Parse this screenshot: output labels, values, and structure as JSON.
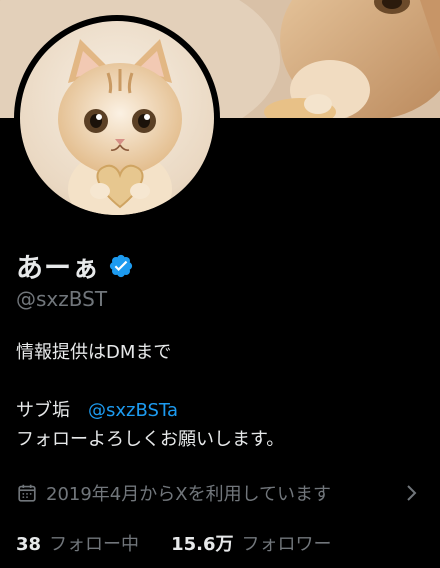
{
  "profile": {
    "display_name": "あーぁ",
    "handle": "@sxzBST",
    "verified_icon": "verified-badge-icon",
    "avatar_icon": "kitten-avatar"
  },
  "bio": {
    "line1": "情報提供はDMまで",
    "line3_label": "サブ垢",
    "line3_mention": "@sxzBSTa",
    "line4": "フォローよろしくお願いします。"
  },
  "joined": {
    "text": "2019年4月からXを利用しています",
    "icon": "calendar-icon"
  },
  "stats": {
    "following_count": "38",
    "following_label": "フォロー中",
    "followers_count": "15.6万",
    "followers_label": "フォロワー"
  },
  "colors": {
    "background": "#000000",
    "text": "#e7e9ea",
    "muted": "#71767b",
    "accent": "#1d9bf0"
  }
}
